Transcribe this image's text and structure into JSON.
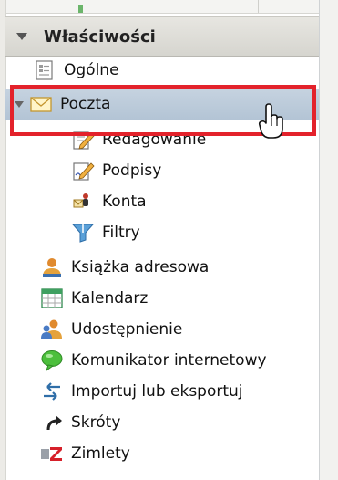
{
  "panel": {
    "title": "Właściwości"
  },
  "items": [
    {
      "key": "ogolne",
      "label": "Ogólne",
      "icon": "document-icon",
      "indent": 1
    },
    {
      "key": "poczta",
      "label": "Poczta",
      "icon": "envelope-icon",
      "indent": 0,
      "expanded": true,
      "selected": true
    },
    {
      "key": "redagowanie",
      "label": "Redagowanie",
      "icon": "compose-icon",
      "indent": 2
    },
    {
      "key": "podpisy",
      "label": "Podpisy",
      "icon": "signature-icon",
      "indent": 2
    },
    {
      "key": "konta",
      "label": "Konta",
      "icon": "accounts-icon",
      "indent": 2
    },
    {
      "key": "filtry",
      "label": "Filtry",
      "icon": "filter-icon",
      "indent": 2
    },
    {
      "key": "ksiazka",
      "label": "Książka adresowa",
      "icon": "address-book-icon",
      "indent": 1
    },
    {
      "key": "kalendarz",
      "label": "Kalendarz",
      "icon": "calendar-icon",
      "indent": 1
    },
    {
      "key": "udostepnienie",
      "label": "Udostępnienie",
      "icon": "sharing-icon",
      "indent": 1
    },
    {
      "key": "komunikator",
      "label": "Komunikator internetowy",
      "icon": "chat-bubble-icon",
      "indent": 1
    },
    {
      "key": "import",
      "label": "Importuj lub eksportuj",
      "icon": "import-export-icon",
      "indent": 1
    },
    {
      "key": "skroty",
      "label": "Skróty",
      "icon": "shortcut-arrow-icon",
      "indent": 1
    },
    {
      "key": "zimlety",
      "label": "Zimlety",
      "icon": "zimlet-icon",
      "indent": 1
    }
  ],
  "colors": {
    "selection": "#b3c4d5",
    "highlight_border": "#e3222b",
    "header": "#d6d5cf"
  }
}
